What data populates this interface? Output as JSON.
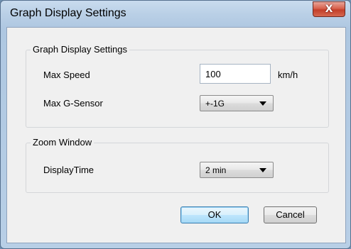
{
  "window": {
    "title": "Graph Display Settings",
    "close_glyph": "X"
  },
  "group_graph": {
    "label": "Graph Display Settings",
    "max_speed": {
      "label": "Max Speed",
      "value": "100",
      "unit": "km/h"
    },
    "max_gsensor": {
      "label": "Max G-Sensor",
      "selected": "+-1G"
    }
  },
  "group_zoom": {
    "label": "Zoom Window",
    "display_time": {
      "label": "DisplayTime",
      "selected": "2 min"
    }
  },
  "buttons": {
    "ok": "OK",
    "cancel": "Cancel"
  },
  "icons": {
    "close": "close-icon",
    "dropdown": "chevron-down-icon"
  }
}
